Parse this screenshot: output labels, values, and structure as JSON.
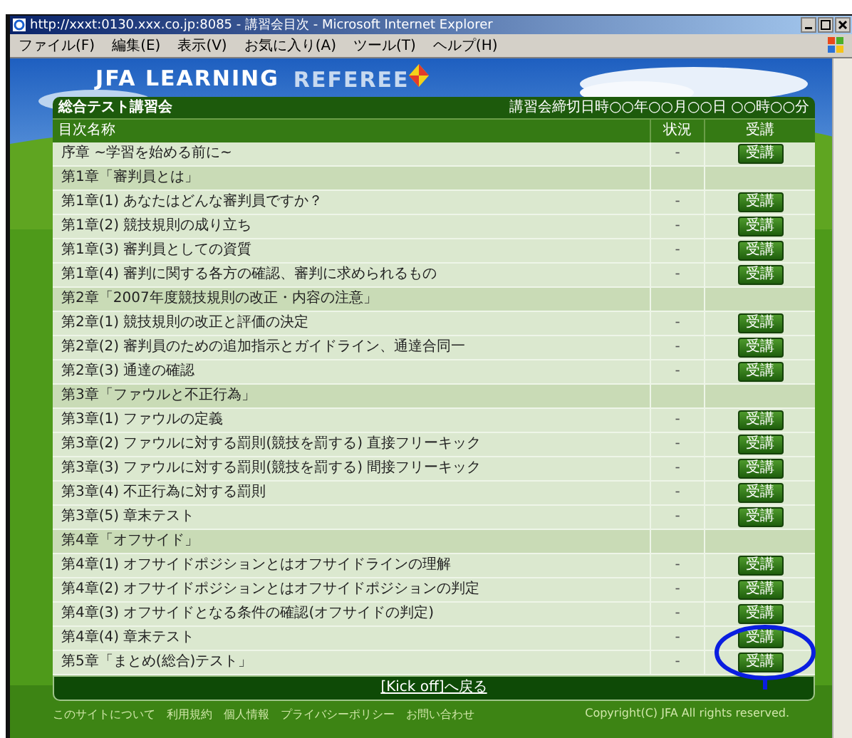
{
  "window": {
    "title": "http://xxxt:0130.xxx.co.jp:8085 - 講習会目次 - Microsoft Internet Explorer"
  },
  "menu": [
    "ファイル(F)",
    "編集(E)",
    "表示(V)",
    "お気に入り(A)",
    "ツール(T)",
    "ヘルプ(H)"
  ],
  "logo": {
    "main": "JFA LEARNING",
    "accent": "REFEREE"
  },
  "panel": {
    "title": "総合テスト講習会",
    "deadline": "講習会締切日時○○年○○月○○日 ○○時○○分",
    "columns": [
      "目次名称",
      "状況",
      "受講"
    ],
    "rows": [
      {
        "kind": "item",
        "name": "序章 ~学習を始める前に~",
        "status": "-",
        "button": "受講"
      },
      {
        "kind": "section",
        "name": "第1章「審判員とは」"
      },
      {
        "kind": "item",
        "name": "第1章(1) あなたはどんな審判員ですか？",
        "status": "-",
        "button": "受講"
      },
      {
        "kind": "item",
        "name": "第1章(2) 競技規則の成り立ち",
        "status": "-",
        "button": "受講"
      },
      {
        "kind": "item",
        "name": "第1章(3) 審判員としての資質",
        "status": "-",
        "button": "受講"
      },
      {
        "kind": "item",
        "name": "第1章(4) 審判に関する各方の確認、審判に求められるもの",
        "status": "-",
        "button": "受講"
      },
      {
        "kind": "section",
        "name": "第2章「2007年度競技規則の改正・内容の注意」"
      },
      {
        "kind": "item",
        "name": "第2章(1) 競技規則の改正と評価の決定",
        "status": "-",
        "button": "受講"
      },
      {
        "kind": "item",
        "name": "第2章(2) 審判員のための追加指示とガイドライン、通達合同一",
        "status": "-",
        "button": "受講"
      },
      {
        "kind": "item",
        "name": "第2章(3) 通達の確認",
        "status": "-",
        "button": "受講"
      },
      {
        "kind": "section",
        "name": "第3章「ファウルと不正行為」"
      },
      {
        "kind": "item",
        "name": "第3章(1) ファウルの定義",
        "status": "-",
        "button": "受講"
      },
      {
        "kind": "item",
        "name": "第3章(2) ファウルに対する罰則(競技を罰する) 直接フリーキック",
        "status": "-",
        "button": "受講"
      },
      {
        "kind": "item",
        "name": "第3章(3) ファウルに対する罰則(競技を罰する) 間接フリーキック",
        "status": "-",
        "button": "受講"
      },
      {
        "kind": "item",
        "name": "第3章(4) 不正行為に対する罰則",
        "status": "-",
        "button": "受講"
      },
      {
        "kind": "item",
        "name": "第3章(5) 章末テスト",
        "status": "-",
        "button": "受講"
      },
      {
        "kind": "section",
        "name": "第4章「オフサイド」"
      },
      {
        "kind": "item",
        "name": "第4章(1) オフサイドポジションとはオフサイドラインの理解",
        "status": "-",
        "button": "受講"
      },
      {
        "kind": "item",
        "name": "第4章(2) オフサイドポジションとはオフサイドポジションの判定",
        "status": "-",
        "button": "受講"
      },
      {
        "kind": "item",
        "name": "第4章(3) オフサイドとなる条件の確認(オフサイドの判定)",
        "status": "-",
        "button": "受講"
      },
      {
        "kind": "item",
        "name": "第4章(4) 章末テスト",
        "status": "-",
        "button": "受講"
      },
      {
        "kind": "item",
        "name": "第5章「まとめ(総合)テスト」",
        "status": "-",
        "button": "受講"
      }
    ],
    "back_link": "[Kick off]へ戻る"
  },
  "footer": {
    "links": [
      "このサイトについて",
      "利用規約",
      "個人情報",
      "プライバシーポリシー",
      "お問い合わせ"
    ],
    "copyright": "Copyright(C) JFA All rights reserved."
  }
}
